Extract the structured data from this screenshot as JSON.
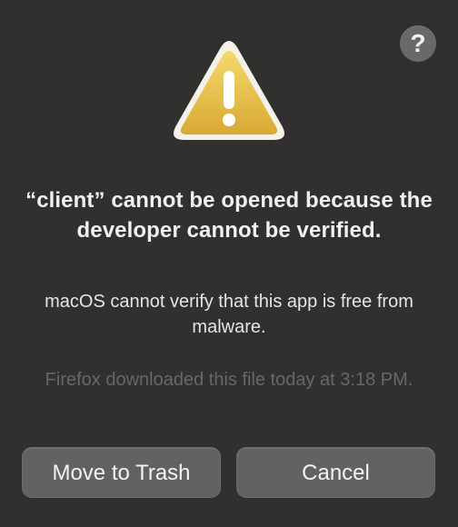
{
  "dialog": {
    "help_label": "?",
    "icon": "warning-triangle-icon",
    "title": "“client” cannot be opened because the developer cannot be verified.",
    "message": "macOS cannot verify that this app is free from malware.",
    "info": "Firefox downloaded this file today at 3:18 PM.",
    "buttons": {
      "move_to_trash": "Move to Trash",
      "cancel": "Cancel"
    }
  },
  "colors": {
    "background": "#32302e",
    "button": "#646260",
    "warning_fill": "#e7c445",
    "warning_border": "#f4f1e8",
    "muted_text": "#696765"
  }
}
